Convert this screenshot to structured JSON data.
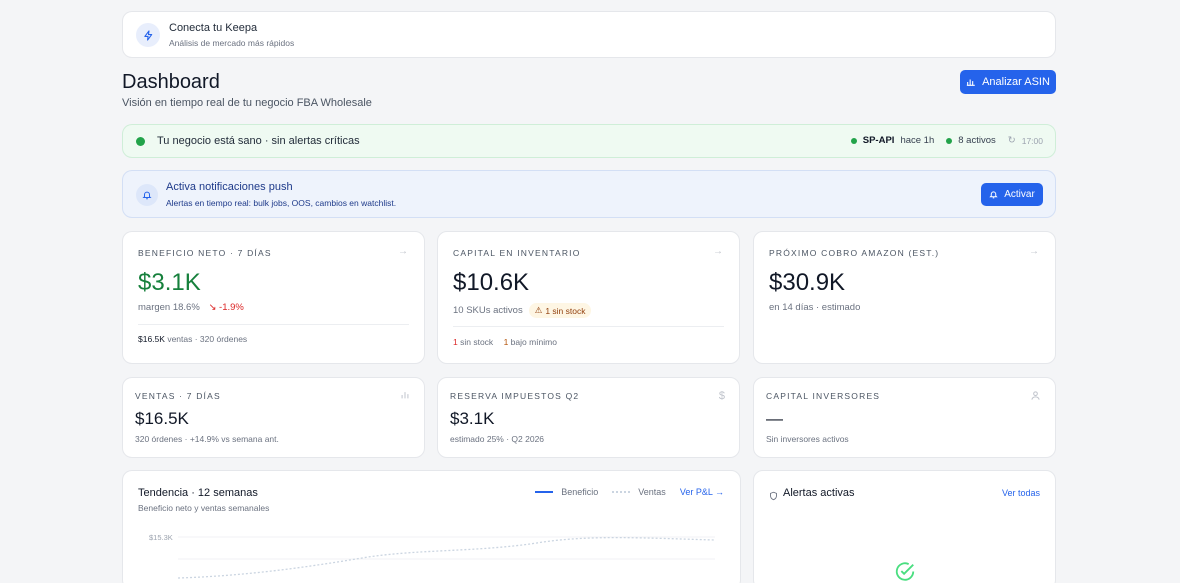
{
  "keepa": {
    "title": "Conecta tu Keepa",
    "subtitle": "Análisis de mercado más rápidos",
    "icon": "bolt-icon"
  },
  "header": {
    "title": "Dashboard",
    "subtitle": "Visión en tiempo real de tu negocio FBA Wholesale",
    "analyze_label": "Analizar ASIN"
  },
  "health": {
    "message": "Tu negocio está sano · sin alertas críticas",
    "api_label": "SP-API",
    "api_time": "hace 1h",
    "active": "8 activos",
    "sync_time": "17:00"
  },
  "notifications": {
    "title": "Activa notificaciones push",
    "subtitle": "Alertas en tiempo real: bulk jobs, OOS, cambios en watchlist.",
    "button": "Activar"
  },
  "kpis": [
    {
      "label": "Beneficio neto · 7 días",
      "value": "$3.1K",
      "margin": "margen 18.6%",
      "delta": "-1.9%",
      "foot_value": "$16.5K",
      "foot_text": "ventas · 320 órdenes"
    },
    {
      "label": "Capital en inventario",
      "value": "$10.6K",
      "skus": "10 SKUs activos",
      "badge": "1 sin stock",
      "foot_a_num": "1",
      "foot_a_text": "sin stock",
      "foot_b_num": "1",
      "foot_b_text": "bajo mínimo"
    },
    {
      "label": "Próximo cobro Amazon (est.)",
      "value": "$30.9K",
      "sub": "en 14 días · estimado"
    }
  ],
  "kpis2": [
    {
      "label": "Ventas · 7 días",
      "value": "$16.5K",
      "sub": "320 órdenes · +14.9% vs semana ant."
    },
    {
      "label": "Reserva impuestos Q2",
      "value": "$3.1K",
      "sub": "estimado 25% · Q2 2026"
    },
    {
      "label": "Capital inversores",
      "value": "—",
      "sub": "Sin inversores activos"
    }
  ],
  "trend": {
    "title": "Tendencia · 12 semanas",
    "subtitle": "Beneficio neto y ventas semanales",
    "legend_a": "Beneficio",
    "legend_b": "Ventas",
    "link": "Ver P&L →",
    "ytick": "$15.3K"
  },
  "alerts": {
    "title": "Alertas activas",
    "link": "Ver todas"
  },
  "colors": {
    "primary": "#2563eb",
    "positive": "#16803c",
    "negative": "#dc2626",
    "warning": "#b45309"
  }
}
